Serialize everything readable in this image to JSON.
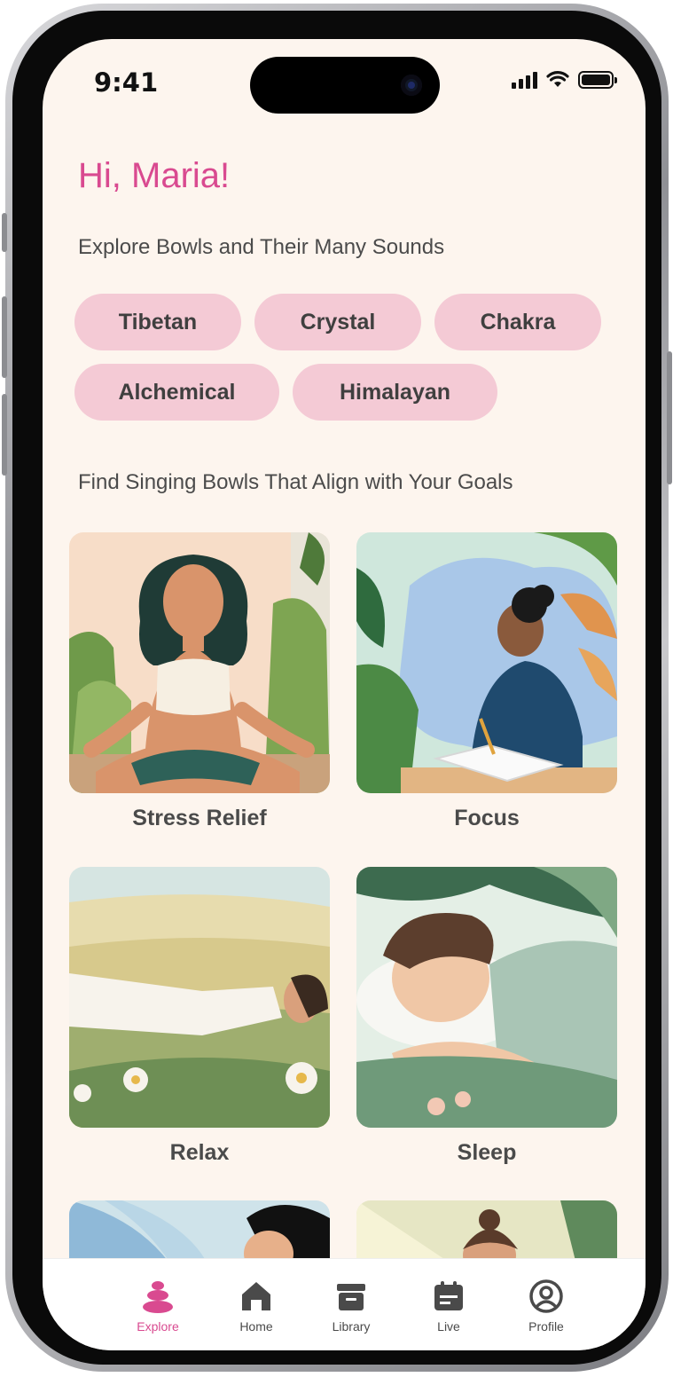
{
  "status_bar": {
    "time": "9:41"
  },
  "greeting": "Hi, Maria!",
  "explore_title": "Explore Bowls and Their Many Sounds",
  "bowl_types": [
    "Tibetan",
    "Crystal",
    "Chakra",
    "Alchemical",
    "Himalayan"
  ],
  "goals_title": "Find Singing Bowls That Align with Your Goals",
  "goals": [
    {
      "label": "Stress Relief",
      "image": "woman-meditating-illustration"
    },
    {
      "label": "Focus",
      "image": "person-writing-illustration"
    },
    {
      "label": "Relax",
      "image": "person-resting-in-meadow-illustration"
    },
    {
      "label": "Sleep",
      "image": "person-sleeping-illustration"
    }
  ],
  "tab_bar": {
    "active": "Explore",
    "items": [
      {
        "label": "Explore",
        "icon": "stacked-stones-icon"
      },
      {
        "label": "Home",
        "icon": "home-icon"
      },
      {
        "label": "Library",
        "icon": "library-icon"
      },
      {
        "label": "Live",
        "icon": "calendar-icon"
      },
      {
        "label": "Profile",
        "icon": "profile-icon"
      }
    ]
  },
  "colors": {
    "accent": "#d94a90",
    "chip_bg": "#f4cad5",
    "screen_bg": "#fdf5ee"
  }
}
